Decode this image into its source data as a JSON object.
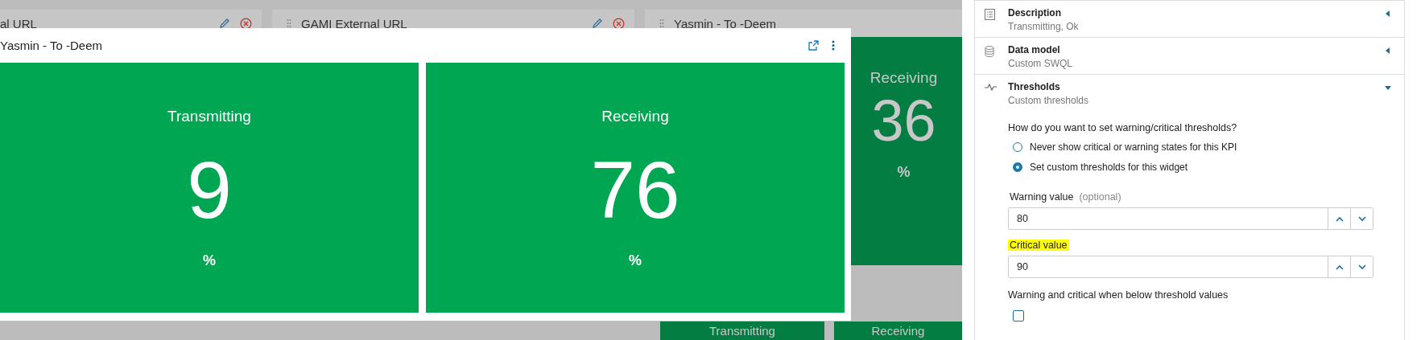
{
  "background_widgets": [
    {
      "title": "al URL",
      "editable": true,
      "draggable": false
    },
    {
      "title": "GAMI External URL",
      "editable": true,
      "draggable": true
    },
    {
      "title": "Yasmin - To -Deem",
      "editable": false,
      "draggable": true,
      "kpis": [
        {
          "label": "Receiving",
          "value": "36",
          "unit": "%"
        }
      ]
    }
  ],
  "background_lower_kpis": [
    {
      "label": "Transmitting"
    },
    {
      "label": "Receiving"
    }
  ],
  "popup": {
    "title": "Yasmin - To -Deem",
    "kpis": [
      {
        "label": "Transmitting",
        "value": "9",
        "unit": "%"
      },
      {
        "label": "Receiving",
        "value": "76",
        "unit": "%"
      }
    ]
  },
  "settings": {
    "sections": [
      {
        "kind": "list",
        "title": "Description",
        "subtitle": "Transmitting, Ok",
        "expanded": false
      },
      {
        "kind": "database",
        "title": "Data model",
        "subtitle": "Custom SWQL",
        "expanded": false
      },
      {
        "kind": "pulse",
        "title": "Thresholds",
        "subtitle": "Custom thresholds",
        "expanded": true
      }
    ],
    "question": "How do you want to set warning/critical thresholds?",
    "options": [
      {
        "label": "Never show critical or warning states for this KPI",
        "selected": false
      },
      {
        "label": "Set custom thresholds for this widget",
        "selected": true
      }
    ],
    "fields": [
      {
        "label": "Warning value",
        "hint": "(optional)",
        "value": "80",
        "highlighted": false
      },
      {
        "label": "Critical value",
        "value": "90",
        "highlighted": true
      }
    ],
    "below": {
      "label": "Warning and critical when below threshold values",
      "checked": false
    }
  }
}
